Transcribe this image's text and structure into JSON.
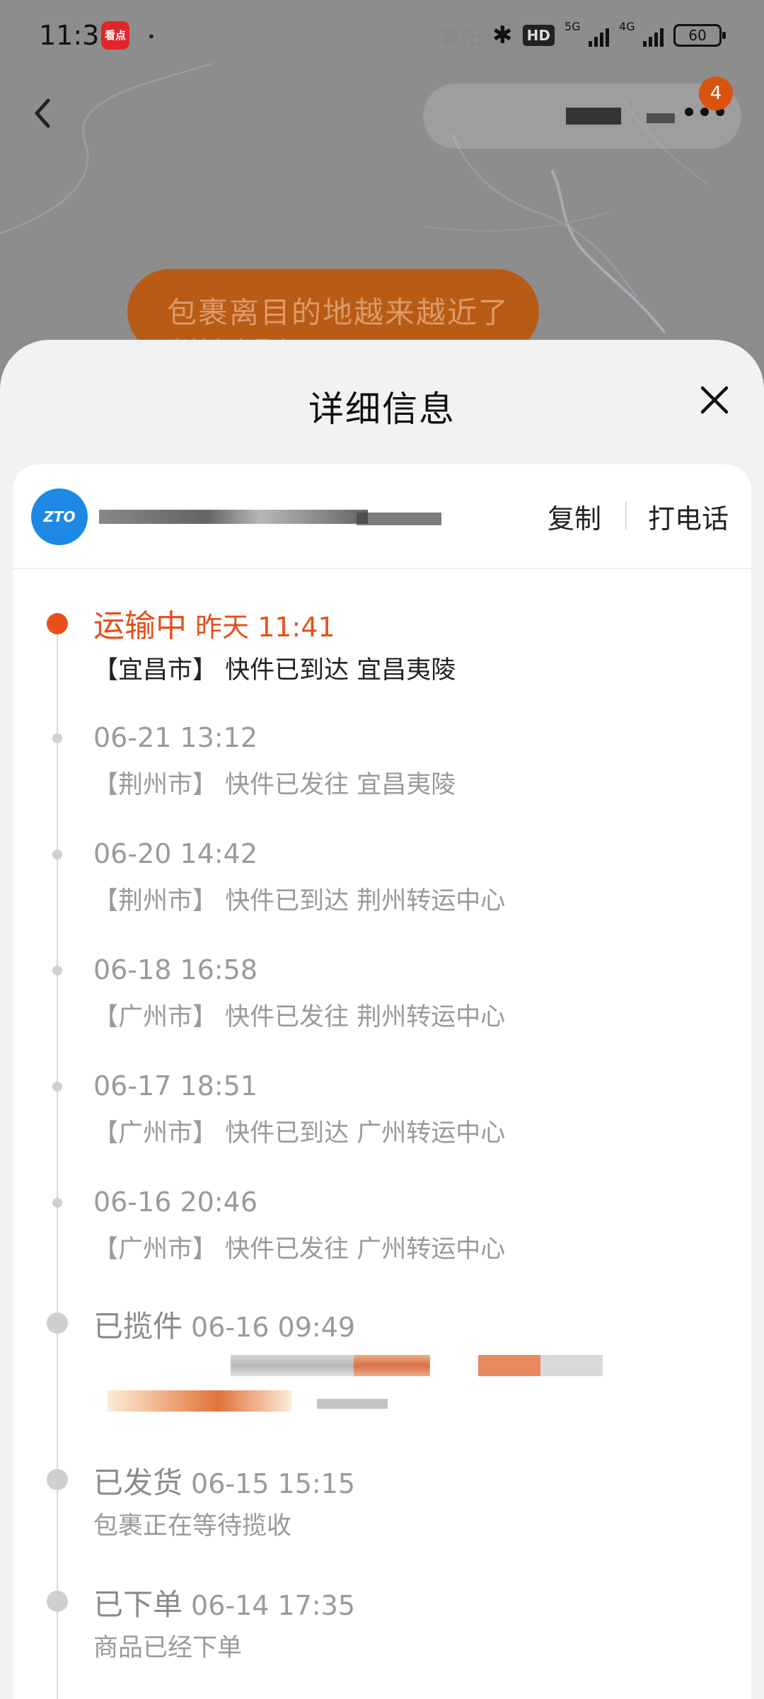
{
  "status_bar": {
    "time": "11:36",
    "app_badge": "看点",
    "location": "襄阳",
    "hd": "HD",
    "net1": "5G",
    "net2": "4G",
    "battery": "60"
  },
  "nav": {
    "notification_count": "4"
  },
  "map": {
    "bubble_text": "包裹离目的地越来越近了",
    "bubble_sub": "当前在宜昌市"
  },
  "sheet": {
    "title": "详细信息",
    "carrier_logo_text": "ZTO",
    "copy_label": "复制",
    "call_label": "打电话"
  },
  "timeline": [
    {
      "status": "运输中",
      "time": "昨天 11:41",
      "desc": "【宜昌市】 快件已到达 宜昌夷陵"
    },
    {
      "status": "",
      "time": "06-21 13:12",
      "desc": "【荆州市】 快件已发往 宜昌夷陵"
    },
    {
      "status": "",
      "time": "06-20 14:42",
      "desc": "【荆州市】 快件已到达 荆州转运中心"
    },
    {
      "status": "",
      "time": "06-18 16:58",
      "desc": "【广州市】 快件已发往 荆州转运中心"
    },
    {
      "status": "",
      "time": "06-17 18:51",
      "desc": "【广州市】 快件已到达 广州转运中心"
    },
    {
      "status": "",
      "time": "06-16 20:46",
      "desc": "【广州市】 快件已发往 广州转运中心"
    },
    {
      "status": "已揽件",
      "time": "06-16 09:49",
      "desc": ""
    },
    {
      "status": "已发货",
      "time": "06-15 15:15",
      "desc": "包裹正在等待揽收"
    },
    {
      "status": "已下单",
      "time": "06-14 17:35",
      "desc": "商品已经下单"
    }
  ],
  "colors": {
    "accent": "#e8501a",
    "carrier_blue": "#1e88e5",
    "muted": "#9a9a9a"
  }
}
